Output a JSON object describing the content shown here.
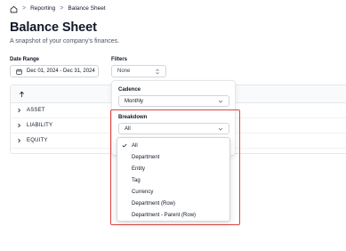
{
  "breadcrumb": {
    "items": [
      "Reporting",
      "Balance Sheet"
    ],
    "separator": ">"
  },
  "page": {
    "title": "Balance Sheet",
    "subtitle": "A snapshot of your company's finances."
  },
  "date_range": {
    "label": "Date Range",
    "value": "Dec 01, 2024 - Dec 31, 2024"
  },
  "filters": {
    "label": "Filters",
    "value": "None"
  },
  "table": {
    "header_sort_icon": "arrow-up-icon",
    "rows": [
      "ASSET",
      "LIABILITY",
      "EQUITY"
    ]
  },
  "popover": {
    "cadence": {
      "label": "Cadence",
      "value": "Monthly"
    },
    "breakdown": {
      "label": "Breakdown",
      "value": "All",
      "options": [
        "All",
        "Department",
        "Entity",
        "Tag",
        "Currency",
        "Department (Row)",
        "Department - Parent (Row)"
      ],
      "selected": "All"
    }
  },
  "colors": {
    "highlight": "#e0453a",
    "border": "#d1d5db",
    "text": "#111827",
    "muted": "#4b5563"
  }
}
